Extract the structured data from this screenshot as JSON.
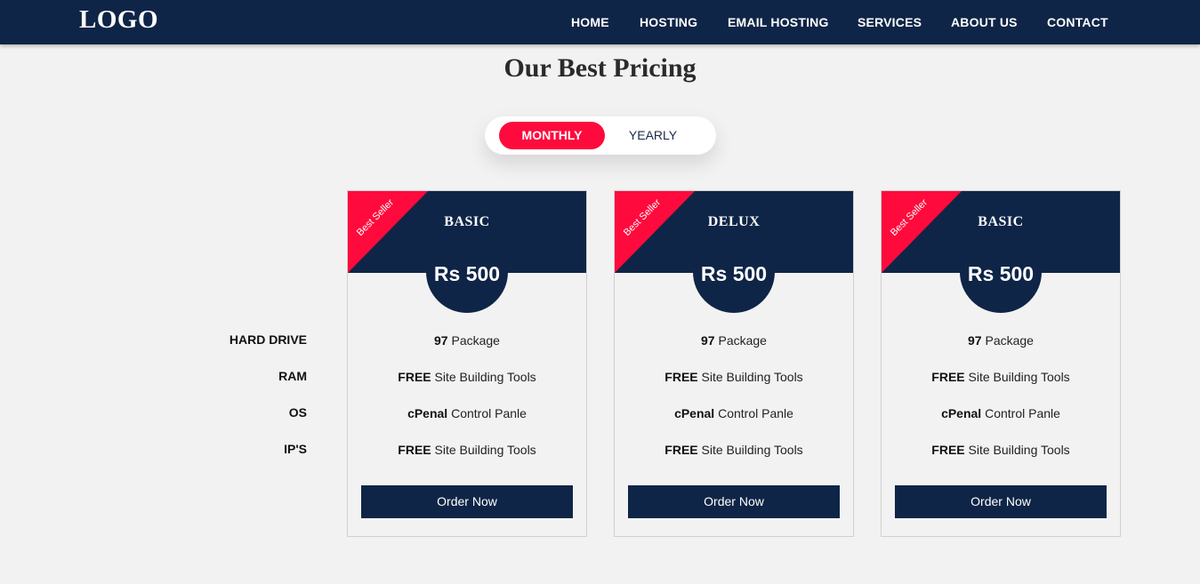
{
  "brand": {
    "logo": "LOGO",
    "accent": "#ff0a3c",
    "navy": "#0f2547"
  },
  "nav": [
    "HOME",
    "HOSTING",
    "EMAIL HOSTING",
    "SERVICES",
    "ABOUT US",
    "CONTACT"
  ],
  "title": "Our Best Pricing",
  "toggle": {
    "monthly": "MONTHLY",
    "yearly": "YEARLY",
    "selected": "MONTHLY"
  },
  "feature_labels": [
    "HARD DRIVE",
    "RAM",
    "OS",
    "IP'S"
  ],
  "plans": [
    {
      "ribbon": "Best Seller",
      "name": "BASIC",
      "price": "Rs 500",
      "features": [
        {
          "bold": "97",
          "text": "Package"
        },
        {
          "bold": "FREE",
          "text": "Site Building Tools"
        },
        {
          "bold": "cPenal",
          "text": "Control Panle"
        },
        {
          "bold": "FREE",
          "text": "Site Building Tools"
        }
      ],
      "button": "Order Now"
    },
    {
      "ribbon": "Best Seller",
      "name": "DELUX",
      "price": "Rs 500",
      "features": [
        {
          "bold": "97",
          "text": "Package"
        },
        {
          "bold": "FREE",
          "text": "Site Building Tools"
        },
        {
          "bold": "cPenal",
          "text": "Control Panle"
        },
        {
          "bold": "FREE",
          "text": "Site Building Tools"
        }
      ],
      "button": "Order Now"
    },
    {
      "ribbon": "Best Seller",
      "name": "BASIC",
      "price": "Rs 500",
      "features": [
        {
          "bold": "97",
          "text": "Package"
        },
        {
          "bold": "FREE",
          "text": "Site Building Tools"
        },
        {
          "bold": "cPenal",
          "text": "Control Panle"
        },
        {
          "bold": "FREE",
          "text": "Site Building Tools"
        }
      ],
      "button": "Order Now"
    }
  ]
}
